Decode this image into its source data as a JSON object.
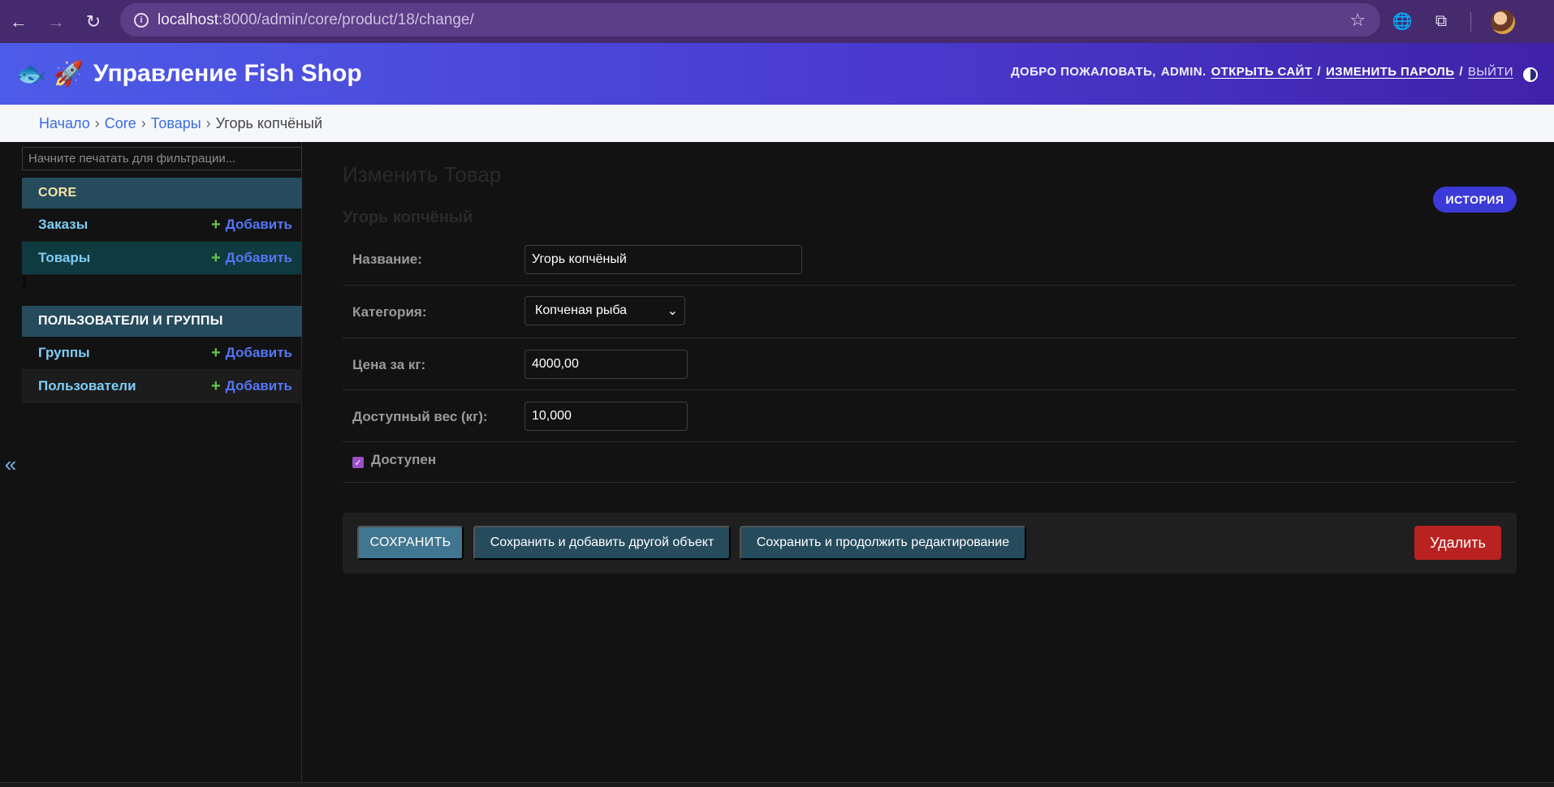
{
  "browser": {
    "url_host": "localhost",
    "url_path": ":8000/admin/core/product/18/change/"
  },
  "header": {
    "site_icons": "🐟 🚀",
    "site_title": "Управление Fish Shop",
    "welcome": "ДОБРО ПОЖАЛОВАТЬ,",
    "username": "ADMIN.",
    "view_site": "ОТКРЫТЬ САЙТ",
    "change_password": "ИЗМЕНИТЬ ПАРОЛЬ",
    "logout": "ВЫЙТИ",
    "separator": "/"
  },
  "breadcrumbs": {
    "home": "Начало",
    "app": "Core",
    "model": "Товары",
    "current": "Угорь копчёный",
    "sep": "›"
  },
  "sidebar": {
    "filter_placeholder": "Начните печатать для фильтрации...",
    "toggle_label": "«",
    "modules": [
      {
        "caption": "CORE",
        "models": [
          {
            "name": "Заказы",
            "add": "Добавить"
          },
          {
            "name": "Товары",
            "add": "Добавить"
          }
        ]
      },
      {
        "caption": "ПОЛЬЗОВАТЕЛИ И ГРУППЫ",
        "models": [
          {
            "name": "Группы",
            "add": "Добавить"
          },
          {
            "name": "Пользователи",
            "add": "Добавить"
          }
        ]
      }
    ]
  },
  "content": {
    "title": "Изменить Товар",
    "subtitle": "Угорь копчёный",
    "history": "ИСТОРИЯ",
    "fields": {
      "name": {
        "label": "Название:",
        "value": "Угорь копчёный"
      },
      "category": {
        "label": "Категория:",
        "value": "Копченая рыба"
      },
      "price": {
        "label": "Цена за кг:",
        "value": "4000,00"
      },
      "weight": {
        "label": "Доступный вес (кг):",
        "value": "10,000"
      },
      "available": {
        "label": "Доступен",
        "checked": true
      }
    },
    "buttons": {
      "save": "СОХРАНИТЬ",
      "save_add": "Сохранить и добавить другой объект",
      "save_continue": "Сохранить и продолжить редактирование",
      "delete": "Удалить"
    }
  },
  "colors": {
    "header_start": "#4d5ce8",
    "header_end": "#3f22a8",
    "module_caption": "#264b5d",
    "save_button": "#417690",
    "delete_button": "#ba2121",
    "history_button": "#3b3ad6"
  }
}
